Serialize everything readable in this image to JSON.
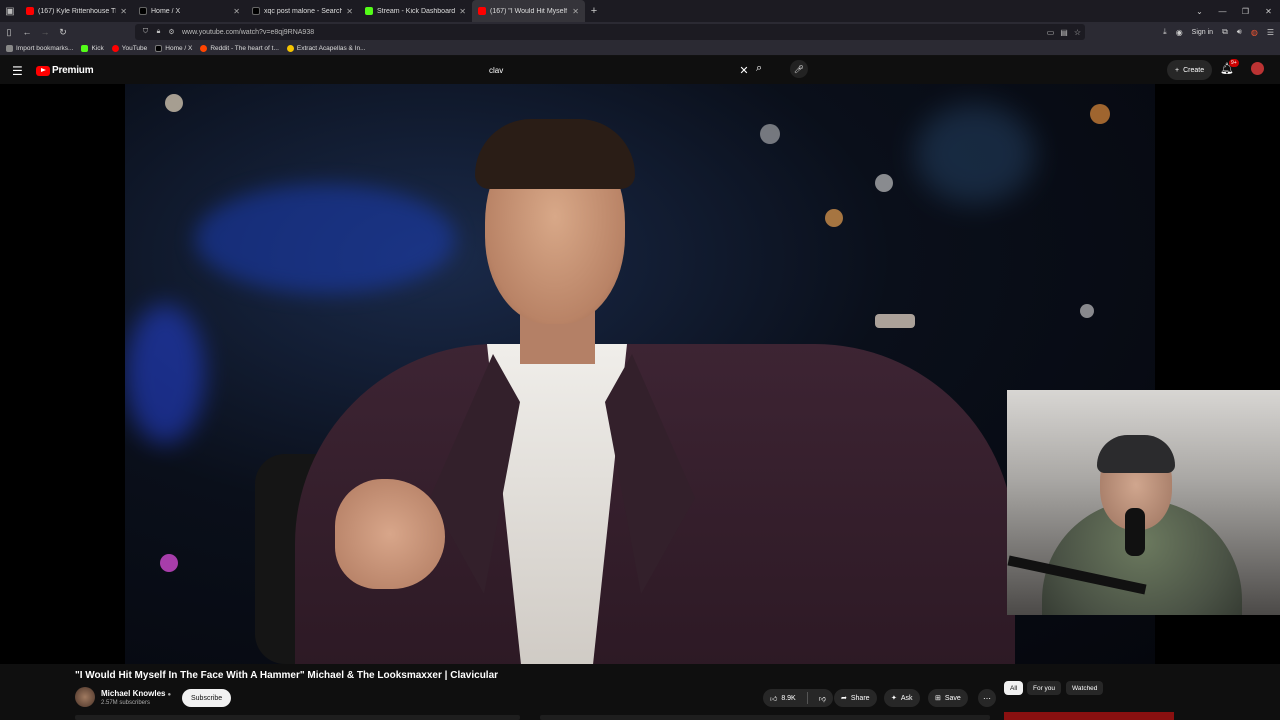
{
  "browser": {
    "tabs": [
      {
        "label": "(167) Kyle Rittenhouse TRASHE",
        "favicon_color": "#ff0000"
      },
      {
        "label": "Home / X",
        "favicon_color": "#000000"
      },
      {
        "label": "xqc post malone - Search / X",
        "favicon_color": "#000000"
      },
      {
        "label": "Stream - Kick Dashboard",
        "favicon_color": "#53fc18"
      },
      {
        "label": "(167) \"I Would Hit Myself I",
        "favicon_color": "#ff0000",
        "active": true
      }
    ],
    "url": "www.youtube.com/watch?v=e8qj9RNA938",
    "sign_in": "Sign in",
    "bookmarks": [
      {
        "label": "Import bookmarks...",
        "color": "#888888"
      },
      {
        "label": "Kick",
        "color": "#53fc18"
      },
      {
        "label": "YouTube",
        "color": "#ff0000"
      },
      {
        "label": "Home / X",
        "color": "#000000"
      },
      {
        "label": "Reddit - The heart of t...",
        "color": "#ff4500"
      },
      {
        "label": "Extract Acapellas & In...",
        "color": "#f5c400"
      }
    ]
  },
  "youtube": {
    "logo_text": "Premium",
    "search_query": "clav",
    "create_label": "Create",
    "notification_count": "9+",
    "video": {
      "title": "\"I Would Hit Myself In The Face With A Hammer\" Michael & The Looksmaxxer | Clavicular",
      "channel": "Michael Knowles",
      "subscribers": "2.57M subscribers",
      "subscribe_label": "Subscribe",
      "likes": "8.9K",
      "share_label": "Share",
      "ask_label": "Ask",
      "save_label": "Save"
    },
    "chips": [
      "All",
      "For you",
      "Watched"
    ]
  }
}
